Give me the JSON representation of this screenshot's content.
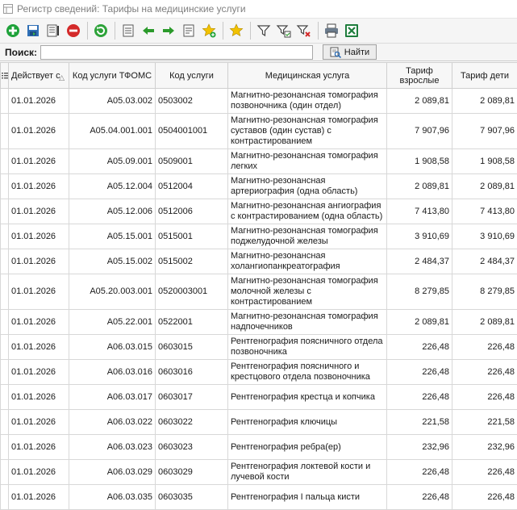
{
  "window": {
    "title": "Регистр сведений: Тарифы на медицинские услуги"
  },
  "toolbar": {
    "buttons": [
      {
        "icon": "add-icon"
      },
      {
        "icon": "save-icon"
      },
      {
        "icon": "report-icon"
      },
      {
        "icon": "delete-icon"
      },
      {
        "icon": "refresh-icon"
      },
      {
        "icon": "list-back-icon"
      },
      {
        "icon": "arrow-left-icon"
      },
      {
        "icon": "arrow-right-icon"
      },
      {
        "icon": "list-forward-icon"
      },
      {
        "icon": "star-add-icon"
      },
      {
        "icon": "star-icon"
      },
      {
        "icon": "filter-icon"
      },
      {
        "icon": "filter-edit-icon"
      },
      {
        "icon": "filter-clear-icon"
      },
      {
        "icon": "print-icon"
      },
      {
        "icon": "excel-icon"
      }
    ]
  },
  "search": {
    "label": "Поиск:",
    "value": "",
    "button_label": "Найти"
  },
  "grid": {
    "columns": {
      "date": "Действует с",
      "tfoms": "Код услуги ТФОМС",
      "code": "Код услуги",
      "name": "Медицинская услуга",
      "adult": "Тариф взрослые",
      "child": "Тариф дети"
    },
    "rows": [
      {
        "date": "01.01.2026",
        "tfoms": "A05.03.002",
        "code": "0503002",
        "name": "Магнитно-резонансная томография позвоночника (один отдел)",
        "adult": "2 089,81",
        "child": "2 089,81"
      },
      {
        "date": "01.01.2026",
        "tfoms": "A05.04.001.001",
        "code": "0504001001",
        "name": "Магнитно-резонансная томография суставов (один сустав) с контрастированием",
        "adult": "7 907,96",
        "child": "7 907,96"
      },
      {
        "date": "01.01.2026",
        "tfoms": "A05.09.001",
        "code": "0509001",
        "name": "Магнитно-резонансная томография легких",
        "adult": "1 908,58",
        "child": "1 908,58"
      },
      {
        "date": "01.01.2026",
        "tfoms": "A05.12.004",
        "code": "0512004",
        "name": "Магнитно-резонансная артериография (одна область)",
        "adult": "2 089,81",
        "child": "2 089,81"
      },
      {
        "date": "01.01.2026",
        "tfoms": "A05.12.006",
        "code": "0512006",
        "name": "Магнитно-резонансная ангиография с контрастированием (одна область)",
        "adult": "7 413,80",
        "child": "7 413,80"
      },
      {
        "date": "01.01.2026",
        "tfoms": "A05.15.001",
        "code": "0515001",
        "name": "Магнитно-резонансная томография поджелудочной железы",
        "adult": "3 910,69",
        "child": "3 910,69"
      },
      {
        "date": "01.01.2026",
        "tfoms": "A05.15.002",
        "code": "0515002",
        "name": "Магнитно-резонансная холангиопанкреатография",
        "adult": "2 484,37",
        "child": "2 484,37"
      },
      {
        "date": "01.01.2026",
        "tfoms": "A05.20.003.001",
        "code": "0520003001",
        "name": "Магнитно-резонансная томография молочной железы с контрастированием",
        "adult": "8 279,85",
        "child": "8 279,85"
      },
      {
        "date": "01.01.2026",
        "tfoms": "A05.22.001",
        "code": "0522001",
        "name": "Магнитно-резонансная томография надпочечников",
        "adult": "2 089,81",
        "child": "2 089,81"
      },
      {
        "date": "01.01.2026",
        "tfoms": "A06.03.015",
        "code": "0603015",
        "name": "Рентгенография поясничного отдела позвоночника",
        "adult": "226,48",
        "child": "226,48"
      },
      {
        "date": "01.01.2026",
        "tfoms": "A06.03.016",
        "code": "0603016",
        "name": "Рентгенография поясничного и крестцового отдела позвоночника",
        "adult": "226,48",
        "child": "226,48"
      },
      {
        "date": "01.01.2026",
        "tfoms": "A06.03.017",
        "code": "0603017",
        "name": "Рентгенография крестца и копчика",
        "adult": "226,48",
        "child": "226,48"
      },
      {
        "date": "01.01.2026",
        "tfoms": "A06.03.022",
        "code": "0603022",
        "name": "Рентгенография ключицы",
        "adult": "221,58",
        "child": "221,58"
      },
      {
        "date": "01.01.2026",
        "tfoms": "A06.03.023",
        "code": "0603023",
        "name": "Рентгенография ребра(ер)",
        "adult": "232,96",
        "child": "232,96"
      },
      {
        "date": "01.01.2026",
        "tfoms": "A06.03.029",
        "code": "0603029",
        "name": "Рентгенография локтевой кости и лучевой кости",
        "adult": "226,48",
        "child": "226,48"
      },
      {
        "date": "01.01.2026",
        "tfoms": "A06.03.035",
        "code": "0603035",
        "name": "Рентгенография I пальца кисти",
        "adult": "226,48",
        "child": "226,48"
      }
    ]
  },
  "colors": {
    "add": "#1fa23a",
    "delete": "#d42a2a",
    "refresh": "#2ea33a",
    "star": "#f2c200",
    "excel": "#1e7d3c",
    "arrow": "#2b9a2b"
  }
}
